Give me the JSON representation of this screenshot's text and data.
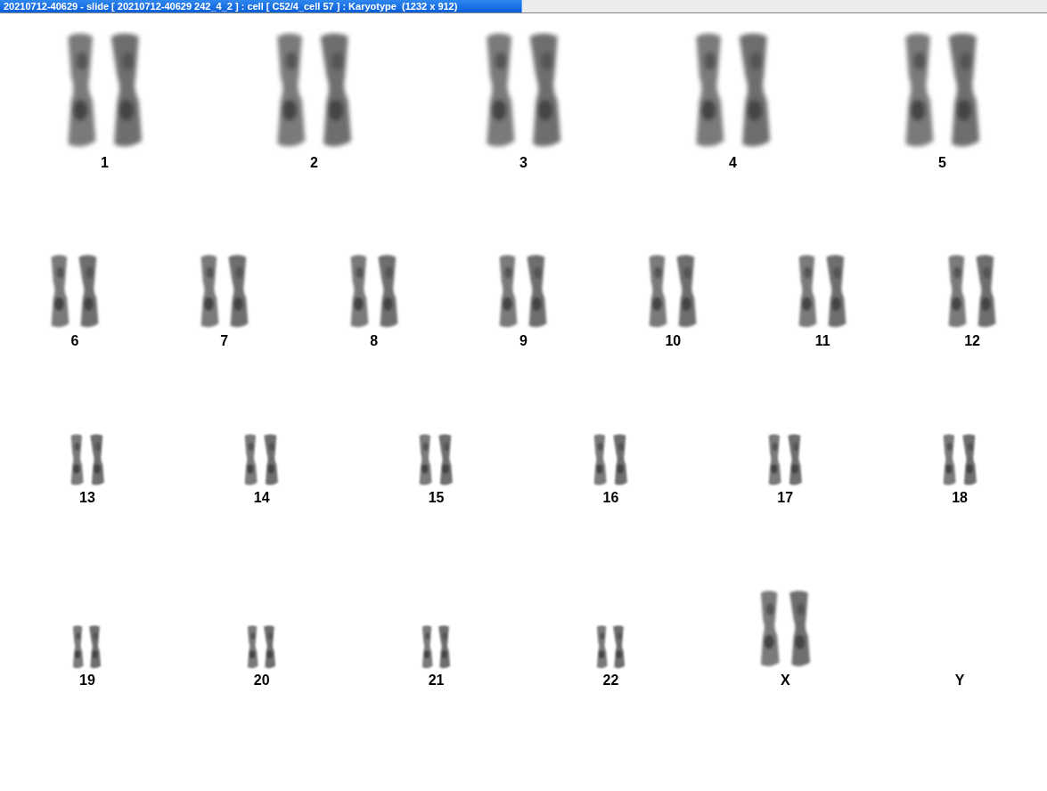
{
  "window": {
    "title": "20210712-40629 - slide [ 20210712-40629 242_4_2 ] : cell [ C52/4_cell 57 ] : Karyotype  (1232 x 912)"
  },
  "rows": [
    {
      "items": [
        {
          "label": "1",
          "kind": "pair"
        },
        {
          "label": "2",
          "kind": "pair"
        },
        {
          "label": "3",
          "kind": "pair"
        },
        {
          "label": "4",
          "kind": "pair"
        },
        {
          "label": "5",
          "kind": "pair"
        }
      ]
    },
    {
      "items": [
        {
          "label": "6",
          "kind": "pair"
        },
        {
          "label": "7",
          "kind": "pair"
        },
        {
          "label": "8",
          "kind": "pair"
        },
        {
          "label": "9",
          "kind": "pair"
        },
        {
          "label": "10",
          "kind": "pair"
        },
        {
          "label": "11",
          "kind": "pair"
        },
        {
          "label": "12",
          "kind": "pair"
        }
      ]
    },
    {
      "items": [
        {
          "label": "13",
          "kind": "pair"
        },
        {
          "label": "14",
          "kind": "pair"
        },
        {
          "label": "15",
          "kind": "pair"
        },
        {
          "label": "16",
          "kind": "pair"
        },
        {
          "label": "17",
          "kind": "pair"
        },
        {
          "label": "18",
          "kind": "pair"
        }
      ]
    },
    {
      "items": [
        {
          "label": "19",
          "kind": "pair"
        },
        {
          "label": "20",
          "kind": "pair"
        },
        {
          "label": "21",
          "kind": "pair"
        },
        {
          "label": "22",
          "kind": "pair"
        },
        {
          "label": "X",
          "kind": "large-pair"
        },
        {
          "label": "Y",
          "kind": "empty"
        }
      ]
    }
  ]
}
